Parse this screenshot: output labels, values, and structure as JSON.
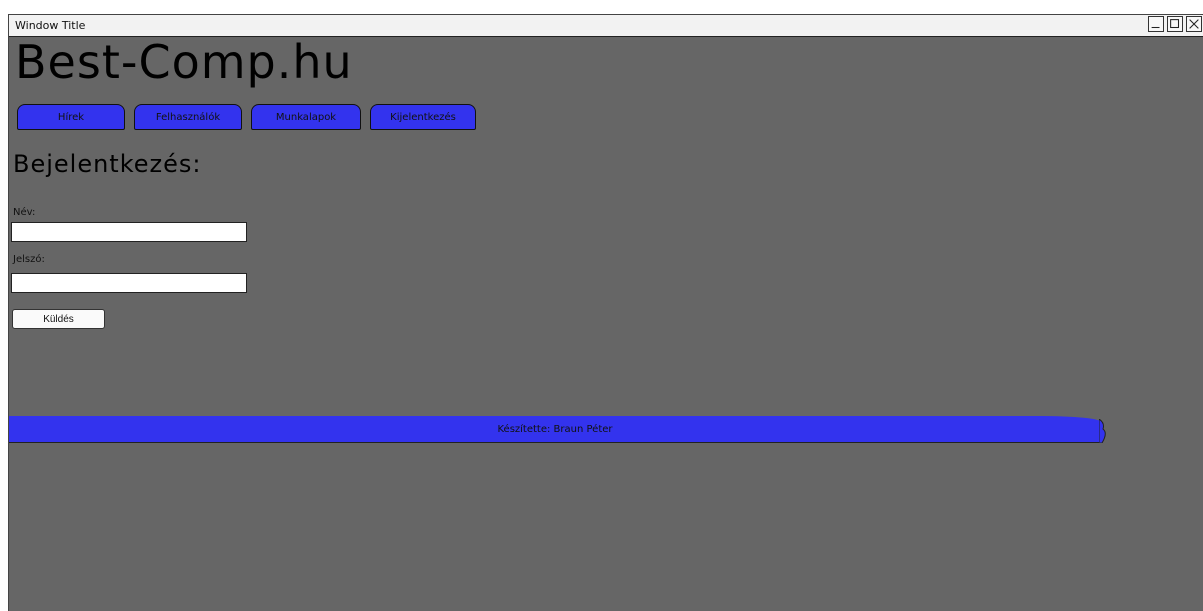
{
  "window": {
    "title": "Window Title"
  },
  "header": {
    "logo": "Best-Comp.hu"
  },
  "nav": {
    "tabs": [
      {
        "label": "Hírek"
      },
      {
        "label": "Felhasználók"
      },
      {
        "label": "Munkalapok"
      },
      {
        "label": "Kijelentkezés"
      }
    ]
  },
  "login": {
    "title": "Bejelentkezés:",
    "name_label": "Név:",
    "name_value": "",
    "password_label": "Jelszó:",
    "password_value": "",
    "submit_label": "Küldés"
  },
  "footer": {
    "text": "Készítette: Braun Péter"
  },
  "colors": {
    "accent": "#3333ee",
    "background": "#666666"
  }
}
